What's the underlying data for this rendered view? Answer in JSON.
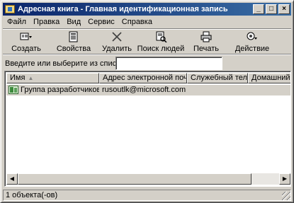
{
  "window": {
    "title": "Адресная книга - Главная идентификационная запись",
    "buttons": {
      "minimize": "_",
      "maximize": "□",
      "close": "×"
    }
  },
  "menu": [
    "Файл",
    "Правка",
    "Вид",
    "Сервис",
    "Справка"
  ],
  "toolbar": [
    {
      "label": "Создать",
      "icon": "new-contact-icon"
    },
    {
      "label": "Свойства",
      "icon": "properties-icon"
    },
    {
      "label": "Удалить",
      "icon": "delete-icon"
    },
    {
      "label": "Поиск людей",
      "icon": "find-people-icon"
    },
    {
      "label": "Печать",
      "icon": "print-icon"
    },
    {
      "label": "Действие",
      "icon": "action-icon"
    }
  ],
  "search": {
    "label": "Введите или выберите из списка:",
    "value": ""
  },
  "list": {
    "columns": [
      "Имя",
      "Адрес электронной почты",
      "Служебный тел...",
      "Домашний те"
    ],
    "rows": [
      {
        "name": "Группа разработчиков ...",
        "email": "rusoutlk@microsoft.com",
        "work_phone": "",
        "home_phone": ""
      }
    ]
  },
  "status": {
    "text": "1 объекта(-ов)"
  }
}
